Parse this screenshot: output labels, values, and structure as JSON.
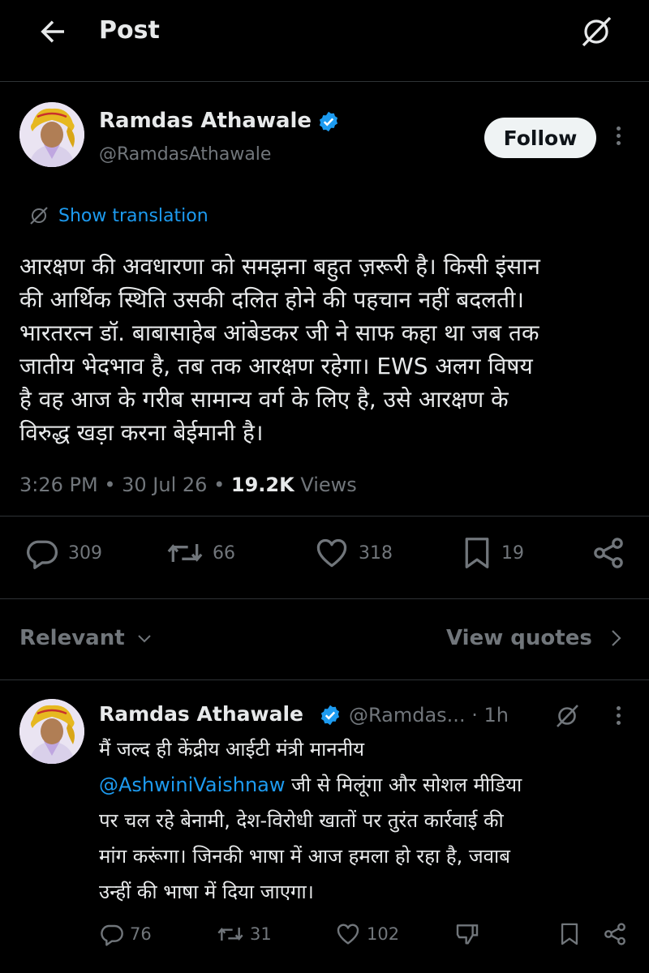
{
  "header": {
    "title": "Post"
  },
  "post": {
    "author_name": "Ramdas Athawale",
    "handle": "@RamdasAthawale",
    "follow_label": "Follow",
    "translate_label": "Show translation",
    "lines": [
      "आरक्षण की अवधारणा को समझना बहुत ज़रूरी है। किसी इंसान",
      "की आर्थिक स्थिति उसकी दलित होने की पहचान नहीं बदलती।",
      "भारतरत्न डॉ. बाबासाहेब आंबेडकर जी ने साफ कहा था जब तक",
      "जातीय भेदभाव है, तब तक आरक्षण रहेगा। EWS अलग विषय",
      "है वह आज के गरीब सामान्य वर्ग के लिए है, उसे आरक्षण के",
      "विरुद्ध खड़ा करना बेईमानी है।"
    ],
    "time": "3:26 PM",
    "date": "30 Jul 26",
    "views_count": "19.2K",
    "views_label": "Views",
    "replies": "309",
    "reposts": "66",
    "likes": "318",
    "bookmarks": "19"
  },
  "filter": {
    "relevant_label": "Relevant",
    "view_quotes_label": "View quotes"
  },
  "reply": {
    "author_name": "Ramdas Athawale",
    "handle": "@Ramdas...",
    "time_ago": "1h",
    "line1": "मैं जल्द ही केंद्रीय आईटी मंत्री माननीय",
    "mention": "@AshwiniVaishnaw",
    "line2_rest": " जी से मिलूंगा और सोशल मीडिया",
    "line3": "पर चल रहे बेनामी, देश-विरोधी खातों पर तुरंत कार्रवाई की",
    "line4": "मांग करूंगा। जिनकी भाषा में आज हमला हो रहा है, जवाब",
    "line5": "उन्हीं की भाषा में दिया जाएगा।",
    "replies": "76",
    "reposts": "31",
    "likes": "102"
  },
  "colors": {
    "accent": "#1d9bf0",
    "muted": "#71767b",
    "text": "#e7e9ea",
    "verified": "#1d9bf0",
    "follow_bg": "#eff3f4"
  }
}
